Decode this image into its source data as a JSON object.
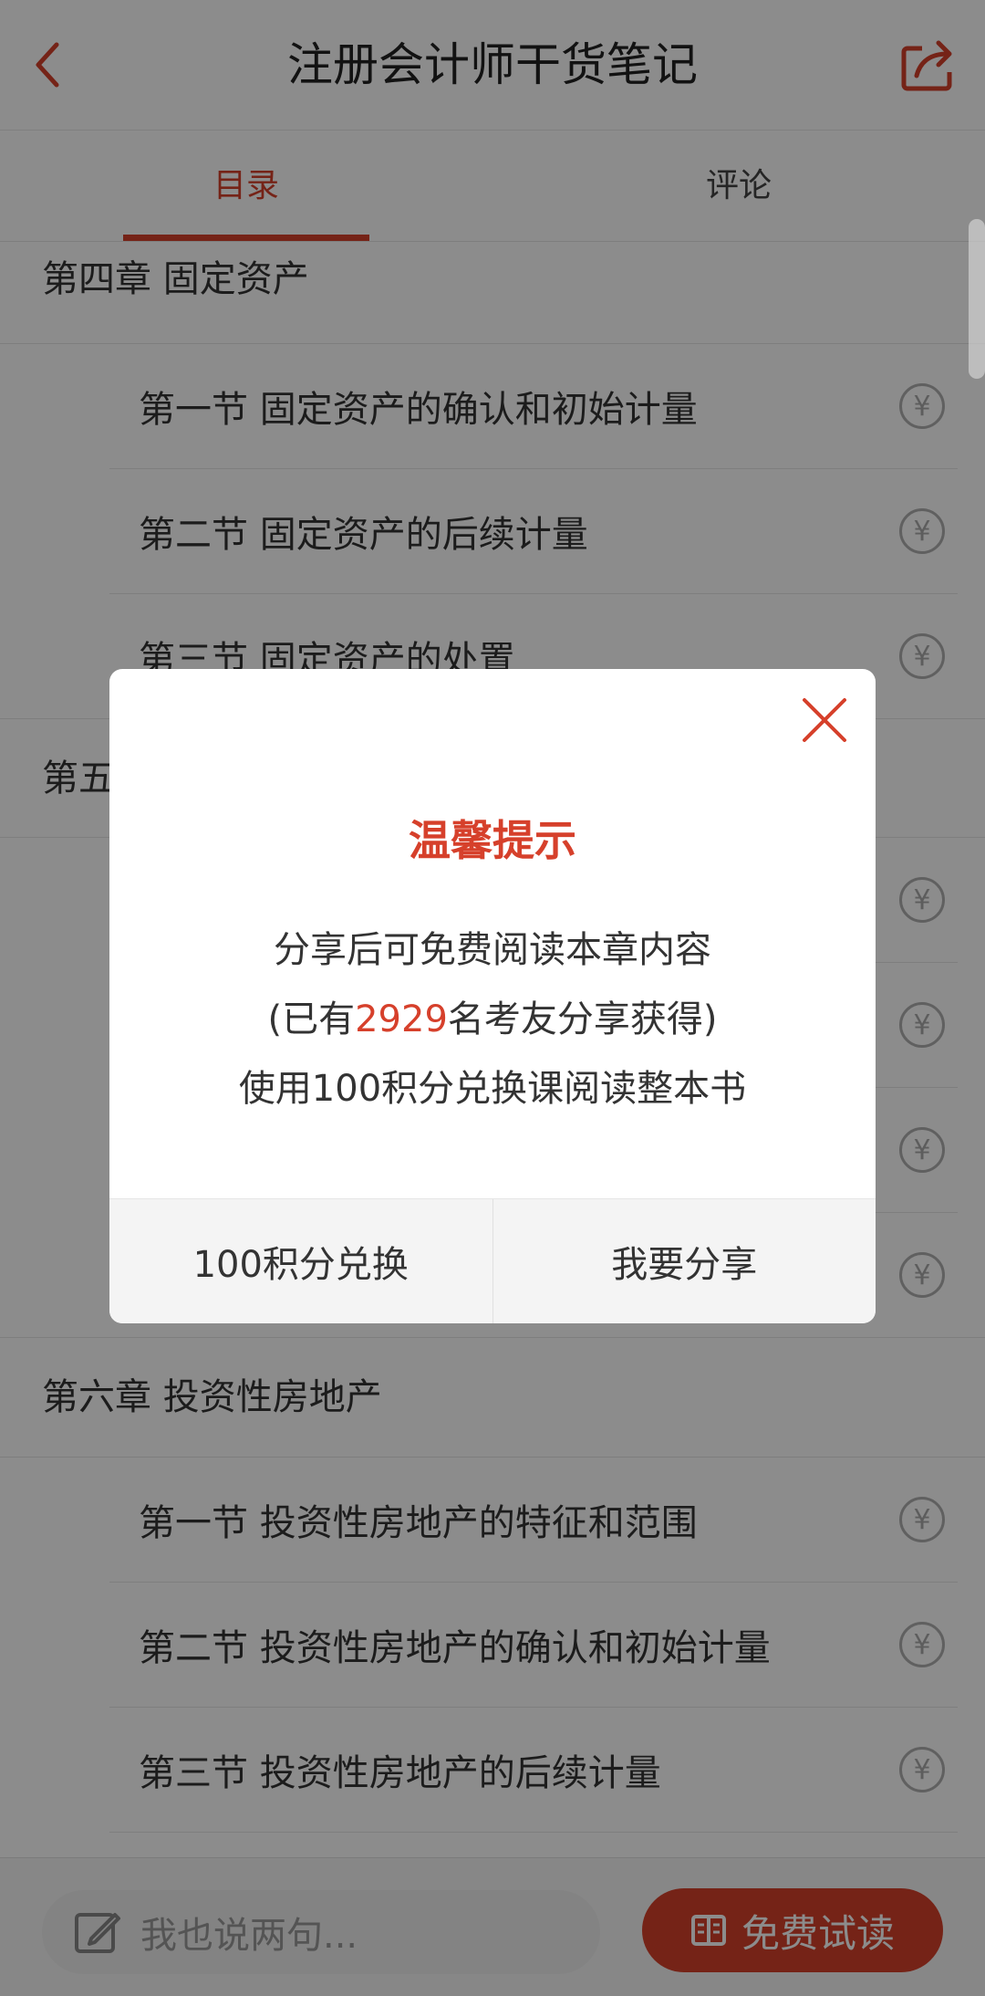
{
  "header": {
    "title": "注册会计师干货笔记",
    "back_icon": "chevron-left-icon",
    "share_icon": "share-icon"
  },
  "tabs": [
    {
      "label": "目录",
      "active": true
    },
    {
      "label": "评论",
      "active": false
    }
  ],
  "catalog": {
    "chapters": [
      {
        "title": "第四章  固定资产",
        "sections": [
          {
            "title": "第一节  固定资产的确认和初始计量"
          },
          {
            "title": "第二节  固定资产的后续计量"
          },
          {
            "title": "第三节  固定资产的处置"
          }
        ]
      },
      {
        "title": "第五",
        "sections": [
          {
            "title": ""
          },
          {
            "title": ""
          },
          {
            "title": ""
          },
          {
            "title": ""
          }
        ]
      },
      {
        "title": "第六章  投资性房地产",
        "sections": [
          {
            "title": "第一节  投资性房地产的特征和范围"
          },
          {
            "title": "第二节  投资性房地产的确认和初始计量"
          },
          {
            "title": "第三节  投资性房地产的后续计量"
          }
        ]
      }
    ],
    "price_icon_glyph": "¥"
  },
  "bottom_bar": {
    "comment_placeholder": "我也说两句...",
    "trial_label": "免费试读"
  },
  "dialog": {
    "title": "温馨提示",
    "line1": "分享后可免费阅读本章内容",
    "line2_prefix": "(已有",
    "line2_count": "2929",
    "line2_suffix": "名考友分享获得)",
    "line3": "使用100积分兑换课阅读整本书",
    "exchange_label": "100积分兑换",
    "share_label": "我要分享"
  },
  "colors": {
    "accent": "#d6402b"
  }
}
